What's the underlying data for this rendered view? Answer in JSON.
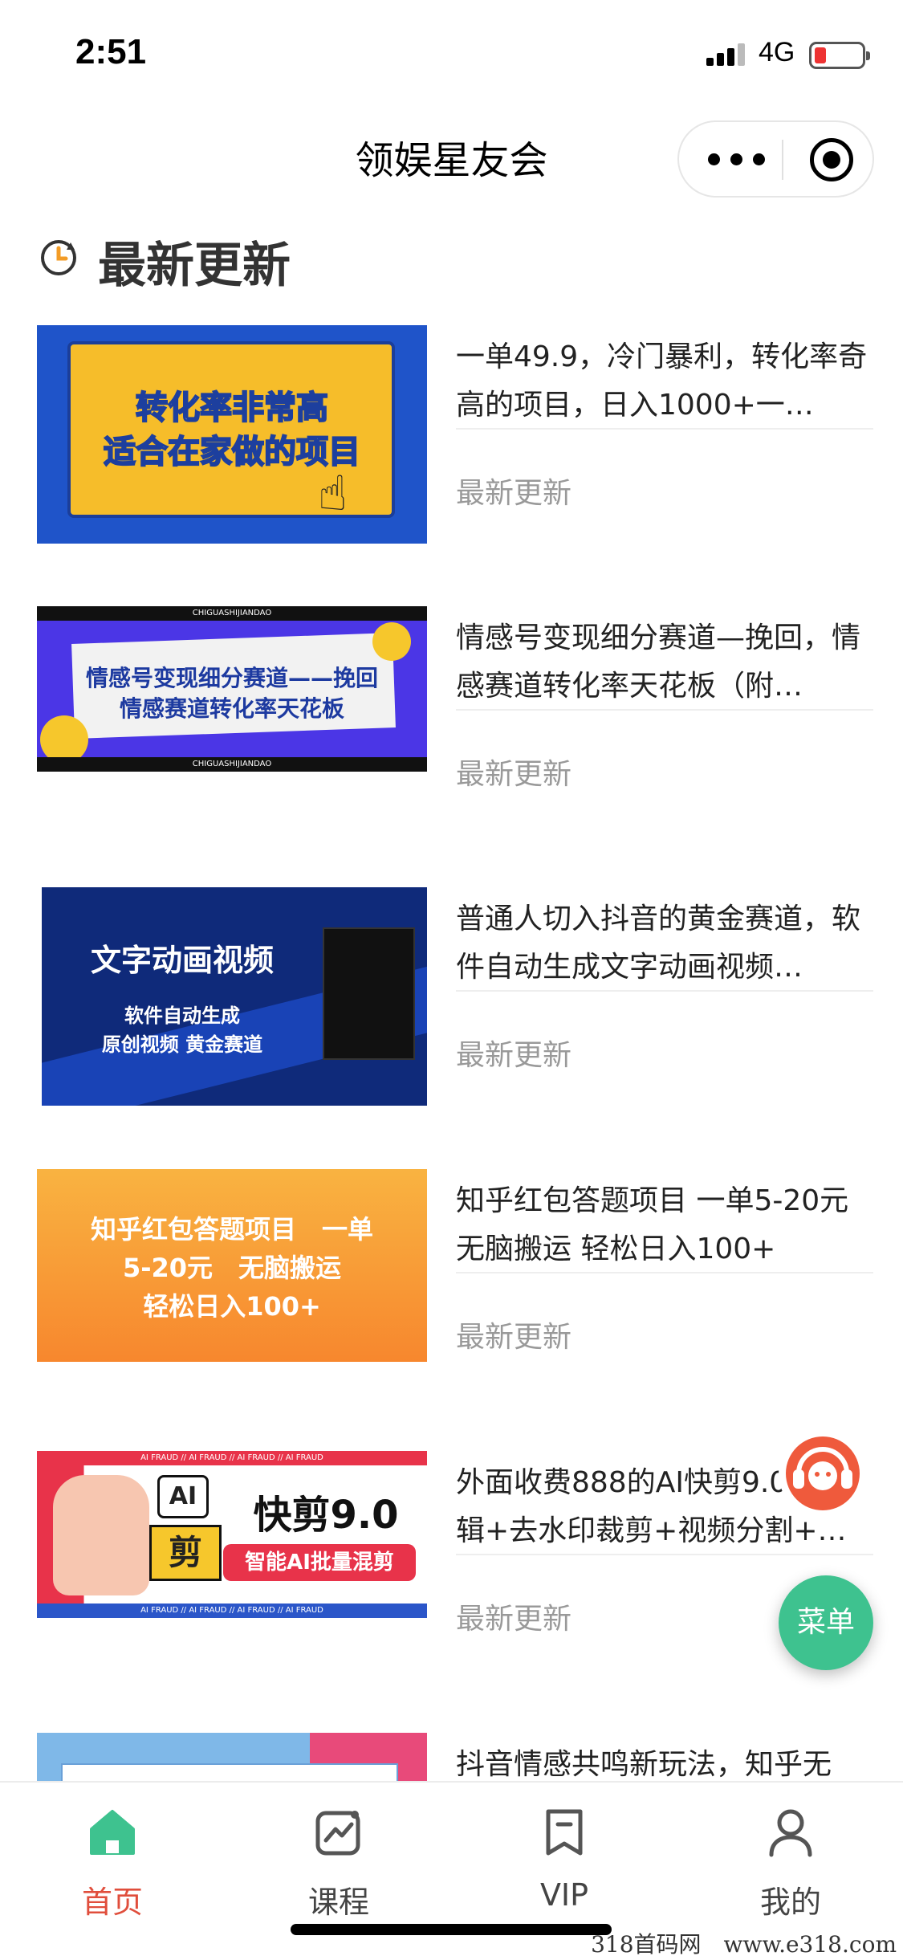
{
  "status_bar": {
    "time": "2:51",
    "network": "4G"
  },
  "nav": {
    "title": "领娱星友会"
  },
  "section": {
    "title": "最新更新"
  },
  "items": [
    {
      "title": "一单49.9，冷门暴利，转化率奇高的项目，日入1000+一…",
      "tag": "最新更新",
      "thumb_line1": "转化率非常高",
      "thumb_line2": "适合在家做的项目"
    },
    {
      "title": "情感号变现细分赛道—挽回，情感赛道转化率天花板（附…",
      "tag": "最新更新",
      "thumb_line1": "情感号变现细分赛道——挽回",
      "thumb_line2": "情感赛道转化率天花板",
      "thumb_strip": "CHIGUASHIJIANDAO"
    },
    {
      "title": "普通人切入抖音的黄金赛道，软件自动生成文字动画视频…",
      "tag": "最新更新",
      "thumb_line1": "文字动画视频",
      "thumb_line2": "软件自动生成",
      "thumb_line3": "原创视频 黄金赛道"
    },
    {
      "title": "知乎红包答题项目 一单5-20元 无脑搬运 轻松日入100+",
      "tag": "最新更新",
      "thumb_line1": "知乎红包答题项目　一单",
      "thumb_line2": "5-20元　无脑搬运",
      "thumb_line3": "轻松日入100+"
    },
    {
      "title": "外面收费888的AI快剪9.0，剪辑+去水印裁剪+视频分割+…",
      "tag": "最新更新",
      "thumb_line1": "快剪9.0",
      "thumb_line2": "智能AI批量混剪",
      "thumb_badge": "AI",
      "thumb_badge2": "剪",
      "thumb_strip": "AI FRAUD // AI FRAUD // AI FRAUD // AI FRAUD"
    },
    {
      "title": "抖音情感共鸣新玩法，知乎无",
      "tag": ""
    }
  ],
  "floating": {
    "menu_label": "菜单"
  },
  "tabbar": {
    "tabs": [
      {
        "label": "首页",
        "icon": "home-icon",
        "active": true
      },
      {
        "label": "课程",
        "icon": "chart-icon",
        "active": false
      },
      {
        "label": "VIP",
        "icon": "bookmark-icon",
        "active": false
      },
      {
        "label": "我的",
        "icon": "user-icon",
        "active": false
      }
    ]
  },
  "watermark": "318首码网　www.e318.com",
  "colors": {
    "accent_green": "#3ec28f",
    "active_red": "#e04e3c",
    "tag_gray": "#999999"
  }
}
